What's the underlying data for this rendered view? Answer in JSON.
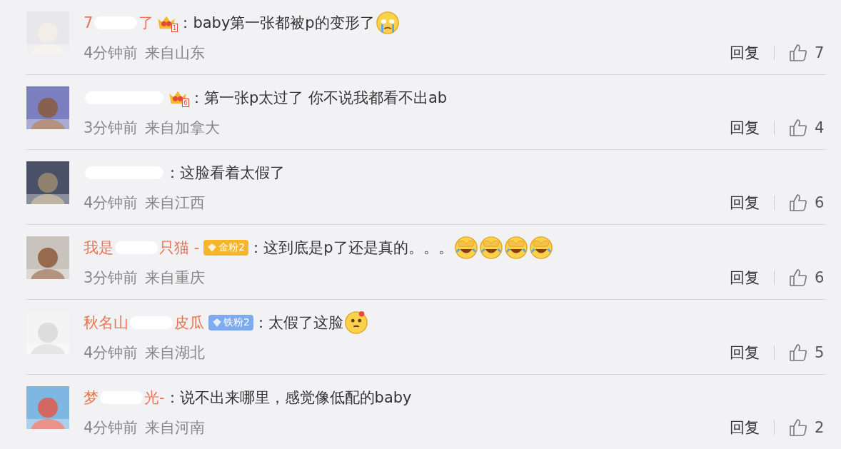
{
  "comments": [
    {
      "avatar": {
        "kind": "picture"
      },
      "name_parts": [
        "7",
        "了"
      ],
      "badge": {
        "kind": "crown",
        "level": "1"
      },
      "text": "：baby第一张都被p的变形了",
      "emojis": [
        {
          "kind": "crying"
        }
      ],
      "time": "4分钟前",
      "location": "来自山东",
      "reply": "回复",
      "likes": "7"
    },
    {
      "avatar": {
        "kind": "picture"
      },
      "badge": {
        "kind": "crown",
        "level": "6"
      },
      "text": "：第一张p太过了 你不说我都看不出ab",
      "time": "3分钟前",
      "location": "来自加拿大",
      "reply": "回复",
      "likes": "4"
    },
    {
      "avatar": {
        "kind": "picture"
      },
      "text": "：这脸看着太假了",
      "time": "4分钟前",
      "location": "来自江西",
      "reply": "回复",
      "likes": "6"
    },
    {
      "avatar": {
        "kind": "picture"
      },
      "name_parts": [
        "我是",
        "只猫 -"
      ],
      "badge": {
        "kind": "fan",
        "label": "金粉2",
        "color": "#f7b52c"
      },
      "text": "：这到底是p了还是真的。。。",
      "emojis": [
        {
          "kind": "facepalm"
        },
        {
          "kind": "facepalm"
        },
        {
          "kind": "facepalm"
        },
        {
          "kind": "facepalm"
        }
      ],
      "time": "3分钟前",
      "location": "来自重庆",
      "reply": "回复",
      "likes": "6"
    },
    {
      "avatar": {
        "kind": "picture"
      },
      "name_parts": [
        "秋名山",
        "皮瓜"
      ],
      "badge": {
        "kind": "fan",
        "label": "铁粉2",
        "color": "#7eaaf2"
      },
      "text": "：太假了这脸",
      "emojis": [
        {
          "kind": "thinking"
        }
      ],
      "time": "4分钟前",
      "location": "来自湖北",
      "reply": "回复",
      "likes": "5"
    },
    {
      "avatar": {
        "kind": "picture"
      },
      "name_parts": [
        "梦",
        "光-"
      ],
      "text": "：说不出来哪里，感觉像低配的baby",
      "time": "4分钟前",
      "location": "来自河南",
      "reply": "回复",
      "likes": "2"
    }
  ]
}
